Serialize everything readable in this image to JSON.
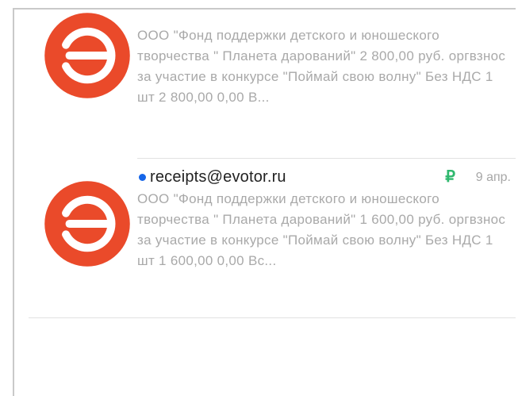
{
  "colors": {
    "logo_red": "#ea4a2a",
    "unread_dot": "#1565e8",
    "ruble_green": "#2fb86e",
    "preview_text": "#a9a9a9"
  },
  "messages": [
    {
      "icon": "evotor-logo-icon",
      "sender": "",
      "unread": false,
      "preview": "ООО \"Фонд поддержки детского и юношеского творчества \" Планета дарований\" 2 800,00 руб. оргвзнос за участие в конкурсе \"Поймай свою волну\" Без НДС 1 шт 2 800,00 0,00 В..."
    },
    {
      "icon": "evotor-logo-icon",
      "sender": "receipts@evotor.ru",
      "unread": true,
      "badge": "₽",
      "date": "9 апр.",
      "preview": "ООО \"Фонд поддержки детского и юношеского творчества \" Планета дарований\" 1 600,00 руб. оргвзнос за участие в конкурсе \"Поймай свою волну\" Без НДС 1 шт 1 600,00 0,00 Вс..."
    }
  ]
}
